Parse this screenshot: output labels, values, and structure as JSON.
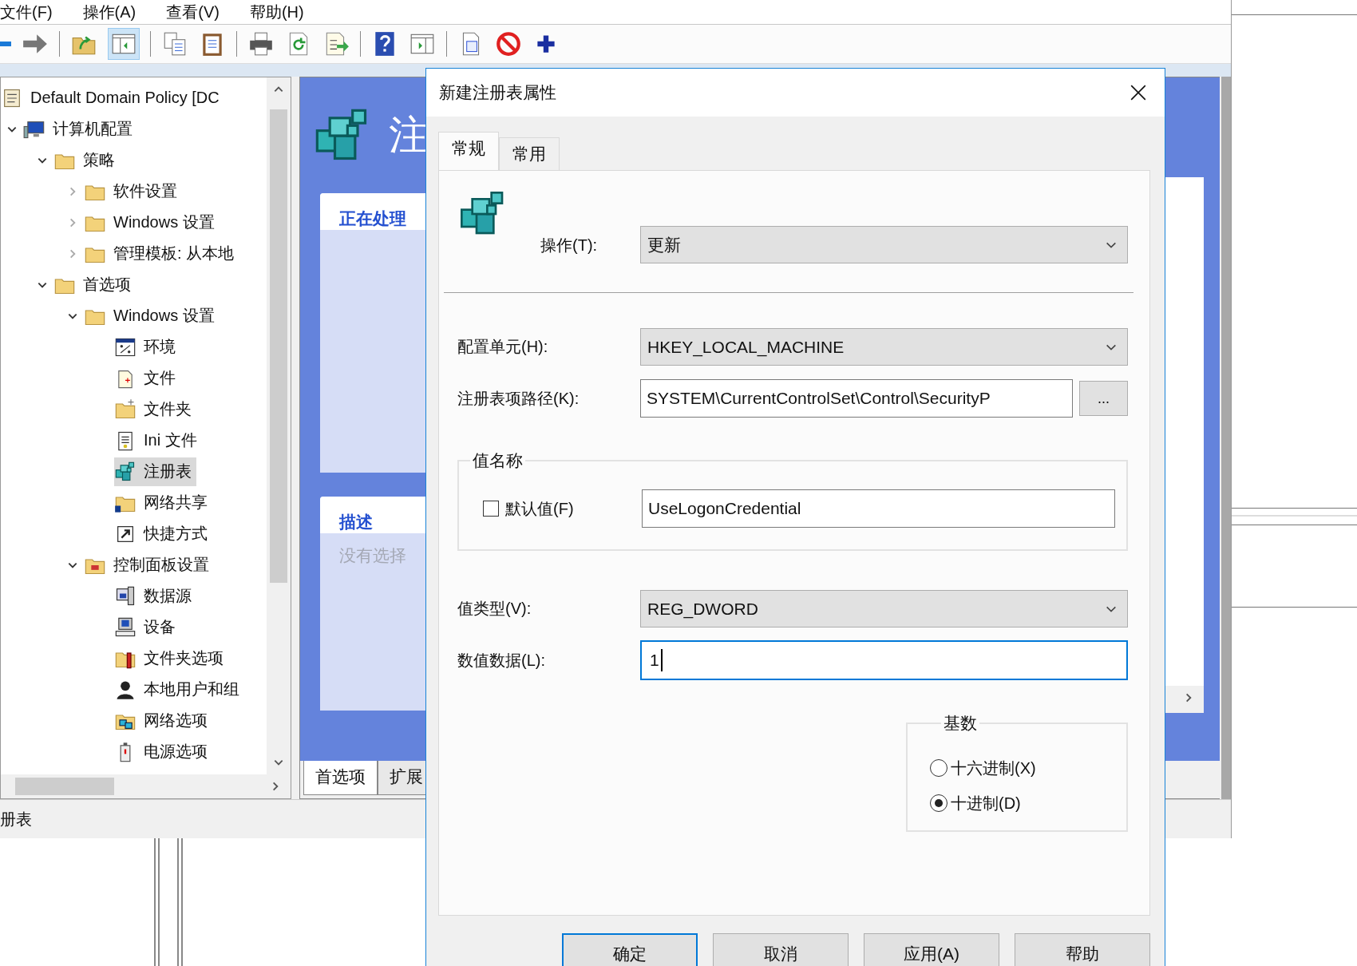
{
  "menu": [
    {
      "label": "文件(F)"
    },
    {
      "label": "操作(A)"
    },
    {
      "label": "查看(V)"
    },
    {
      "label": "帮助(H)"
    }
  ],
  "toolbar": {
    "pane_toggle_pressed": true
  },
  "tree": {
    "items": [
      {
        "label": "Default Domain Policy [DC",
        "kind": "policy",
        "selected": false,
        "children": [
          {
            "label": "计算机配置",
            "kind": "computer",
            "selected": false,
            "expanded": true,
            "children": [
              {
                "label": "策略",
                "kind": "folder",
                "selected": false,
                "expanded": true,
                "children": [
                  {
                    "label": "软件设置",
                    "kind": "folder",
                    "selected": false,
                    "expanded": false
                  },
                  {
                    "label": "Windows 设置",
                    "kind": "folder",
                    "selected": false,
                    "expanded": false
                  },
                  {
                    "label": "管理模板: 从本地",
                    "kind": "folder",
                    "selected": false,
                    "expanded": false
                  }
                ]
              },
              {
                "label": "首选项",
                "kind": "folder",
                "selected": false,
                "expanded": true,
                "children": [
                  {
                    "label": "Windows 设置",
                    "kind": "folder",
                    "selected": false,
                    "expanded": true,
                    "children": [
                      {
                        "label": "环境",
                        "kind": "environment",
                        "selected": false
                      },
                      {
                        "label": "文件",
                        "kind": "file",
                        "selected": false
                      },
                      {
                        "label": "文件夹",
                        "kind": "new-folder",
                        "selected": false
                      },
                      {
                        "label": "Ini 文件",
                        "kind": "ini",
                        "selected": false
                      },
                      {
                        "label": "注册表",
                        "kind": "registry",
                        "selected": true
                      },
                      {
                        "label": "网络共享",
                        "kind": "share",
                        "selected": false
                      },
                      {
                        "label": "快捷方式",
                        "kind": "shortcut",
                        "selected": false
                      }
                    ]
                  },
                  {
                    "label": "控制面板设置",
                    "kind": "control-panel",
                    "selected": false,
                    "expanded": true,
                    "children": [
                      {
                        "label": "数据源",
                        "kind": "data-source",
                        "selected": false
                      },
                      {
                        "label": "设备",
                        "kind": "device",
                        "selected": false
                      },
                      {
                        "label": "文件夹选项",
                        "kind": "folder-options",
                        "selected": false
                      },
                      {
                        "label": "本地用户和组",
                        "kind": "users",
                        "selected": false
                      },
                      {
                        "label": "网络选项",
                        "kind": "network",
                        "selected": false
                      },
                      {
                        "label": "电源选项",
                        "kind": "power",
                        "selected": false
                      }
                    ]
                  }
                ]
              }
            ]
          }
        ]
      }
    ]
  },
  "content": {
    "title": "注",
    "cards": [
      {
        "heading": "正在处理"
      },
      {
        "heading": "描述",
        "text": "没有选择"
      }
    ],
    "tabs": [
      {
        "label": "首选项",
        "selected": true
      },
      {
        "label": "扩展",
        "selected": false
      }
    ]
  },
  "status_bar": "册表",
  "dialog": {
    "title": "新建注册表属性",
    "tabs": [
      {
        "label": "常规",
        "selected": true
      },
      {
        "label": "常用",
        "selected": false
      }
    ],
    "action": {
      "label": "操作(T):",
      "value": "更新"
    },
    "hive": {
      "label": "配置单元(H):",
      "value": "HKEY_LOCAL_MACHINE"
    },
    "key_path": {
      "label": "注册表项路径(K):",
      "value": "SYSTEM\\CurrentControlSet\\Control\\SecurityP",
      "browse": "..."
    },
    "value_name": {
      "legend": "值名称",
      "default_label": "默认值(F)",
      "default_checked": false,
      "value": "UseLogonCredential"
    },
    "value_type": {
      "label": "值类型(V):",
      "value": "REG_DWORD"
    },
    "value_data": {
      "label": "数值数据(L):",
      "value": "1",
      "focused": true
    },
    "base": {
      "legend": "基数",
      "options": [
        {
          "label": "十六进制(X)",
          "selected": false
        },
        {
          "label": "十进制(D)",
          "selected": true
        }
      ]
    },
    "buttons": [
      {
        "label": "确定",
        "default": true
      },
      {
        "label": "取消",
        "default": false
      },
      {
        "label": "应用(A)",
        "default": false
      },
      {
        "label": "帮助",
        "default": false
      }
    ]
  }
}
